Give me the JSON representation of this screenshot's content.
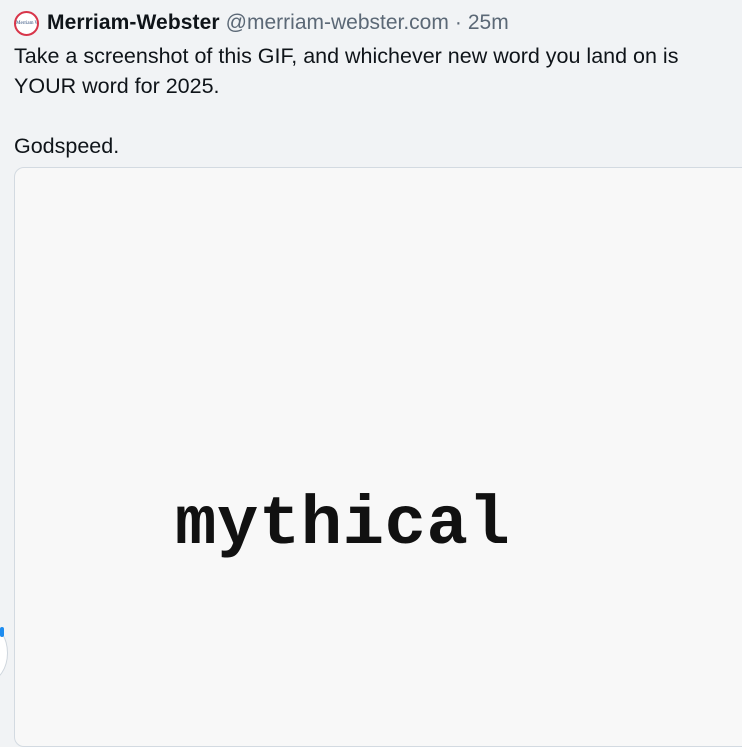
{
  "post": {
    "author_name": "Merriam-Webster",
    "handle": "@merriam-webster.com",
    "separator": "·",
    "time": "25m",
    "avatar_icon": "merriam-webster-logo-icon",
    "avatar_text": "Merriam Webster",
    "text_lines": [
      "Take a screenshot of this GIF, and whichever new word you land on is YOUR word for 2025.",
      "Godspeed."
    ]
  },
  "media": {
    "gif_word": "mythical"
  },
  "colors": {
    "background": "#f1f3f5",
    "text": "#0f1419",
    "muted": "#5b6876",
    "avatar_ring": "#d8354a",
    "accent": "#1d8cf0"
  }
}
